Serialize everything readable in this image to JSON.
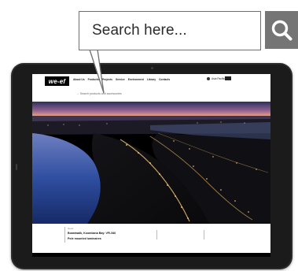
{
  "callout": {
    "text": "Search here..."
  },
  "tablet_site": {
    "logo": "we-ef",
    "nav_items": [
      "About Us",
      "Products",
      "Projects",
      "Service",
      "Environment",
      "Library",
      "Contacts"
    ],
    "region": "Asia Pacific",
    "search_placeholder": "→ Search products and accessories",
    "news": {
      "label": "News",
      "title_line1": "Boardwalk, Koombana Bay: VFL540",
      "title_line2": "Pole mounted luminaires"
    }
  },
  "colors": {
    "callout_border": "#6f6f6f",
    "search_box_bg": "#757575",
    "tablet_frame": "#2a2a2a",
    "logo_bg": "#000000"
  },
  "icons": {
    "search": "magnifier-icon"
  }
}
